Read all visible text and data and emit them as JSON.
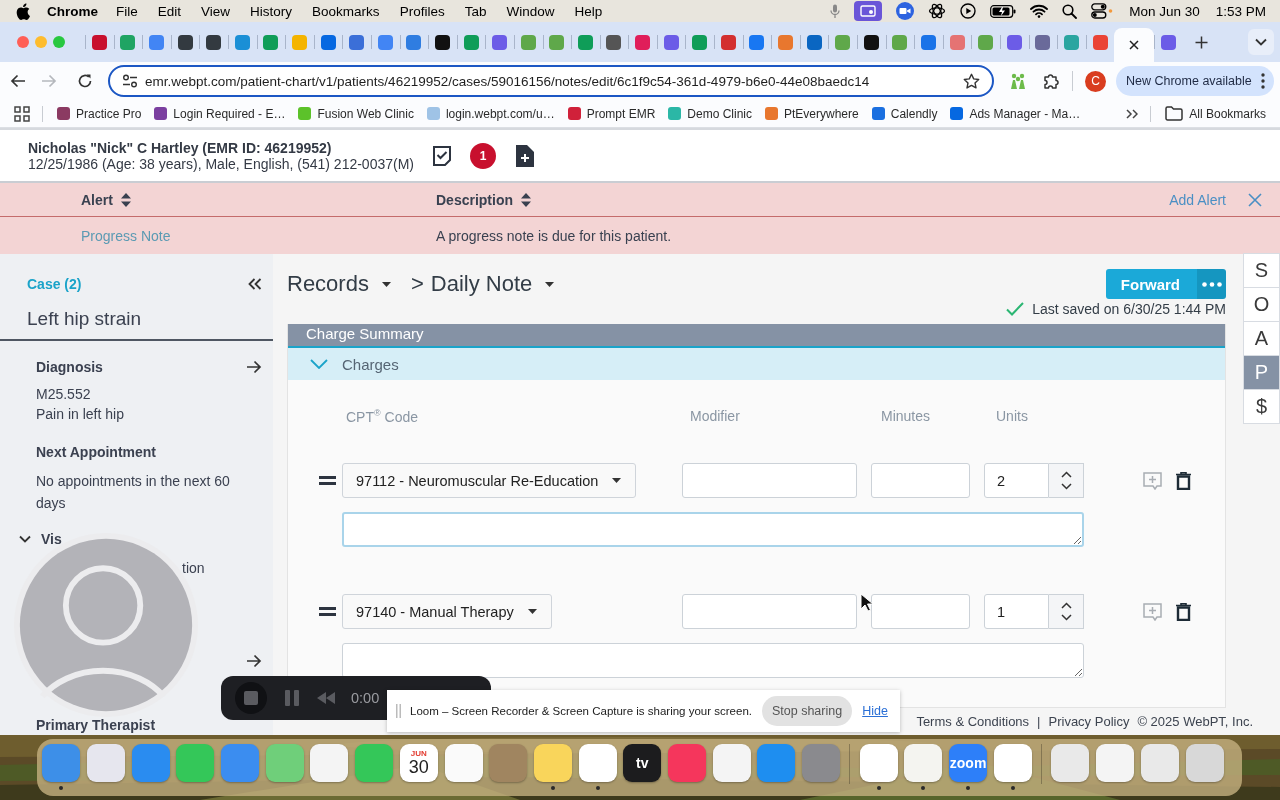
{
  "menubar": {
    "app": "Chrome",
    "menus": [
      "File",
      "Edit",
      "View",
      "History",
      "Bookmarks",
      "Profiles",
      "Tab",
      "Window",
      "Help"
    ],
    "date": "Mon Jun 30",
    "time": "1:53 PM"
  },
  "tabs": [
    {
      "color": "#c8102e",
      "selected": false
    },
    {
      "color": "#1fa463",
      "selected": false
    },
    {
      "color": "#4285f4",
      "selected": false
    },
    {
      "color": "#333a40",
      "selected": false
    },
    {
      "color": "#333a40",
      "selected": false
    },
    {
      "color": "#1a8fd6",
      "selected": false
    },
    {
      "color": "#0f9d58",
      "selected": false
    },
    {
      "color": "#f4b400",
      "selected": false
    },
    {
      "color": "#0668e1",
      "selected": false
    },
    {
      "color": "#3b6fd8",
      "selected": false
    },
    {
      "color": "#4285f4",
      "selected": false
    },
    {
      "color": "#2f7de1",
      "selected": false
    },
    {
      "color": "#111111",
      "selected": false
    },
    {
      "color": "#0f9d58",
      "selected": false
    },
    {
      "color": "#6c5ce7",
      "selected": false
    },
    {
      "color": "#5fa84a",
      "selected": false
    },
    {
      "color": "#5fa84a",
      "selected": false
    },
    {
      "color": "#0f9d58",
      "selected": false
    },
    {
      "color": "#555555",
      "selected": false
    },
    {
      "color": "#e01e5a",
      "selected": false
    },
    {
      "color": "#6b5ce7",
      "selected": false
    },
    {
      "color": "#0f9d58",
      "selected": false
    },
    {
      "color": "#d32f2f",
      "selected": false
    },
    {
      "color": "#1877f2",
      "selected": false
    },
    {
      "color": "#e8772e",
      "selected": false
    },
    {
      "color": "#0a66c2",
      "selected": false
    },
    {
      "color": "#5fa84a",
      "selected": false
    },
    {
      "color": "#111111",
      "selected": false
    },
    {
      "color": "#5fa84a",
      "selected": false
    },
    {
      "color": "#1a73e8",
      "selected": false
    },
    {
      "color": "#e57373",
      "selected": false
    },
    {
      "color": "#5fa84a",
      "selected": false
    },
    {
      "color": "#6c5ce7",
      "selected": false
    },
    {
      "color": "#6a6a9a",
      "selected": false
    },
    {
      "color": "#2aa5a0",
      "selected": false
    },
    {
      "color": "#ea4335",
      "selected": false
    },
    {
      "selected": true
    },
    {
      "color": "#6b5ce7",
      "selected": false
    }
  ],
  "toolbar": {
    "url": "emr.webpt.com/patient-chart/v1/patients/46219952/cases/59016156/notes/edit/6c1f9c54-361d-4979-b6e0-44e08baedc14",
    "profile_initial": "C",
    "update_notice": "New Chrome available"
  },
  "bookmarks": [
    {
      "label": "Practice Pro",
      "color": "#8b3a62"
    },
    {
      "label": "Login Required - E…",
      "color": "#7b3fa0"
    },
    {
      "label": "Fusion Web Clinic",
      "color": "#5cc22a"
    },
    {
      "label": "login.webpt.com/u…",
      "color": "#9fc3e6"
    },
    {
      "label": "Prompt EMR",
      "color": "#d0213a"
    },
    {
      "label": "Demo Clinic",
      "color": "#2bb7a6"
    },
    {
      "label": "PtEverywhere",
      "color": "#e8772e"
    },
    {
      "label": "Calendly",
      "color": "#1a6fe0"
    },
    {
      "label": "Ads Manager - Ma…",
      "color": "#0668e1"
    }
  ],
  "all_bookmarks": "All Bookmarks",
  "patient": {
    "name": "Nicholas \"Nick\" C Hartley (EMR ID: 46219952)",
    "details": "12/25/1986 (Age: 38 years), Male, English, (541) 212-0037(M)",
    "alert_count": "1"
  },
  "alerts": {
    "columns": [
      "Alert",
      "Description"
    ],
    "add_label": "Add Alert",
    "rows": [
      {
        "alert": "Progress Note",
        "description": "A progress note is due for this patient."
      }
    ]
  },
  "sidebar": {
    "case_label": "Case (2)",
    "case_name": "Left hip strain",
    "diagnosis": {
      "heading": "Diagnosis",
      "code": "M25.552",
      "description": "Pain in left hip"
    },
    "next_appointment": {
      "heading": "Next Appointment",
      "text": "No appointments in the next 60 days"
    },
    "visits": {
      "heading": "Vis",
      "expanded": true,
      "line": "tion"
    },
    "primary_therapist": {
      "heading": "Primary Therapist"
    }
  },
  "note": {
    "breadcrumb_root": "Records",
    "separator": ">",
    "note_type": "Daily Note",
    "forward_label": "Forward",
    "last_saved": "Last saved on 6/30/25 1:44 PM",
    "section": "Charge Summary",
    "subsection": "Charges",
    "subsection_expanded": true,
    "columns": [
      "CPT$^{®}$ Code",
      "Modifier",
      "Minutes",
      "Units"
    ],
    "charges": [
      {
        "code": "97112 - Neuromuscular Re-Education",
        "units": "2",
        "notes_focused": true
      },
      {
        "code": "97140 - Manual Therapy",
        "units": "1",
        "notes_focused": false
      }
    ]
  },
  "soap_nav": [
    {
      "label": "S",
      "selected": false
    },
    {
      "label": "O",
      "selected": false
    },
    {
      "label": "A",
      "selected": false
    },
    {
      "label": "P",
      "selected": true
    },
    {
      "label": "$",
      "selected": false
    }
  ],
  "recorder": {
    "time": "0:00",
    "message": "Loom – Screen Recorder & Screen Capture is sharing your screen.",
    "stop_label": "Stop sharing",
    "hide_label": "Hide"
  },
  "footer": {
    "terms": "Terms & Conditions",
    "separator": "|",
    "privacy": "Privacy Policy",
    "copyright": "© 2025 WebPT, Inc."
  },
  "dock_sections": [
    {
      "items": [
        {
          "color": "#3d8fe8",
          "running": true
        },
        {
          "color": "#e6e6ee",
          "running": false
        },
        {
          "color": "#2a8cf0",
          "running": false
        },
        {
          "color": "#34c759",
          "running": false
        },
        {
          "color": "#3b8df0",
          "running": false
        },
        {
          "color": "#6fcf7a",
          "running": false
        },
        {
          "color": "#f4f4f4",
          "running": false
        },
        {
          "color": "#34c759",
          "running": false
        },
        {
          "color": "#ffffff",
          "running": false,
          "lines": [
            "JUN",
            "30"
          ]
        },
        {
          "color": "#fafafa",
          "running": false
        },
        {
          "color": "#a08560",
          "running": false
        },
        {
          "color": "#f9d55b",
          "running": true
        },
        {
          "color": "#ffffff",
          "running": true
        },
        {
          "color": "#1c1c1e",
          "running": false,
          "lines": [
            "tv"
          ]
        },
        {
          "color": "#f5365c",
          "running": false
        },
        {
          "color": "#f4f4f4",
          "running": false
        },
        {
          "color": "#1e8ef0",
          "running": false
        },
        {
          "color": "#8a8a8e",
          "running": false
        }
      ]
    },
    {
      "items": [
        {
          "color": "#ffffff",
          "running": true
        },
        {
          "color": "#f4f4f0",
          "running": true
        },
        {
          "color": "#2d7ff9",
          "running": true,
          "lines": [
            "zoom"
          ]
        },
        {
          "color": "#ffffff",
          "running": true
        }
      ]
    },
    {
      "items": [
        {
          "color": "#e9e9e9",
          "running": false
        },
        {
          "color": "#f4f4f4",
          "running": false
        },
        {
          "color": "#e9e9e9",
          "running": false
        },
        {
          "color": "#d8d8d8",
          "running": false
        }
      ]
    }
  ]
}
